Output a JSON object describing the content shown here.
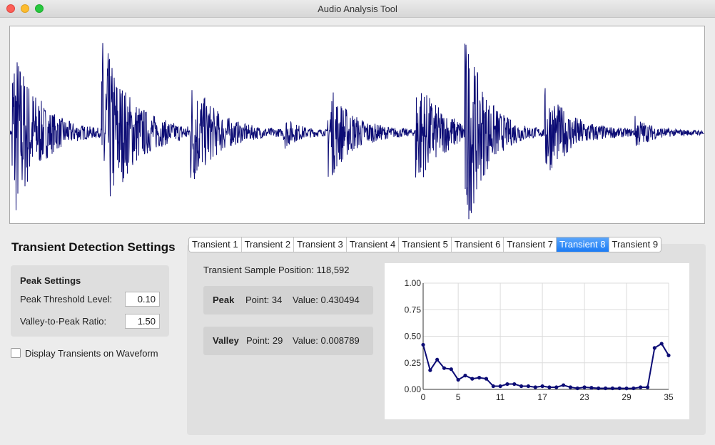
{
  "window": {
    "title": "Audio Analysis Tool"
  },
  "waveform": {
    "color": "#0c0c75",
    "transient_onsets": [
      0.003,
      0.132,
      0.26,
      0.394,
      0.457,
      0.584,
      0.655,
      0.77,
      0.9
    ]
  },
  "settings": {
    "title": "Transient Detection Settings",
    "peak_group_title": "Peak Settings",
    "threshold_label": "Peak Threshold Level:",
    "threshold_value": "0.10",
    "ratio_label": "Valley-to-Peak Ratio:",
    "ratio_value": "1.50",
    "display_label": "Display Transients on Waveform",
    "display_checked": false
  },
  "tabs": {
    "items": [
      "Transient 1",
      "Transient 2",
      "Transient 3",
      "Transient 4",
      "Transient 5",
      "Transient 6",
      "Transient 7",
      "Transient 8",
      "Transient 9"
    ],
    "active_index": 7
  },
  "detail": {
    "sample_position": "Transient Sample Position: 118,592",
    "peak": {
      "label": "Peak",
      "point": "Point: 34",
      "value": "Value: 0.430494"
    },
    "valley": {
      "label": "Valley",
      "point": "Point: 29",
      "value": "Value: 0.008789"
    }
  },
  "chart_data": {
    "type": "line",
    "x": [
      0,
      1,
      2,
      3,
      4,
      5,
      6,
      7,
      8,
      9,
      10,
      11,
      12,
      13,
      14,
      15,
      16,
      17,
      18,
      19,
      20,
      21,
      22,
      23,
      24,
      25,
      26,
      27,
      28,
      29,
      30,
      31,
      32,
      33,
      34,
      35
    ],
    "values": [
      0.42,
      0.18,
      0.28,
      0.2,
      0.19,
      0.09,
      0.13,
      0.1,
      0.11,
      0.1,
      0.03,
      0.03,
      0.05,
      0.05,
      0.03,
      0.03,
      0.02,
      0.03,
      0.02,
      0.02,
      0.04,
      0.02,
      0.01,
      0.02,
      0.015,
      0.01,
      0.01,
      0.01,
      0.01,
      0.009,
      0.01,
      0.02,
      0.02,
      0.39,
      0.43,
      0.32
    ],
    "xticks": [
      0,
      5,
      11,
      17,
      23,
      29,
      35
    ],
    "yticks": [
      0.0,
      0.25,
      0.5,
      0.75,
      1.0
    ],
    "ytick_labels": [
      "0.00",
      "0.25",
      "0.50",
      "0.75",
      "1.00"
    ],
    "xlim": [
      0,
      35
    ],
    "ylim": [
      0,
      1.0
    ],
    "grid": true,
    "color": "#0c0c75"
  }
}
